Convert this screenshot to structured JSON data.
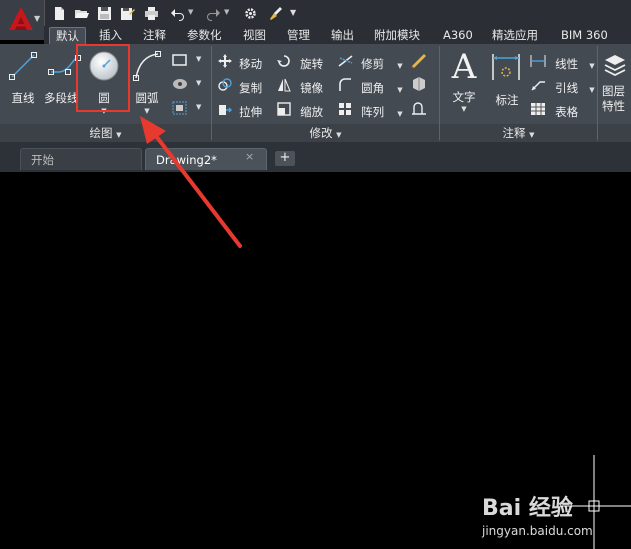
{
  "ribbon_tabs": [
    "默认",
    "插入",
    "注释",
    "参数化",
    "视图",
    "管理",
    "输出",
    "附加模块",
    "A360",
    "精选应用",
    "BIM 360"
  ],
  "draw_panel": {
    "title": "绘图",
    "line_label": "直线",
    "polyline_label": "多段线",
    "circle_label": "圆",
    "arc_label": "圆弧"
  },
  "modify_panel": {
    "title": "修改",
    "move": "移动",
    "rotate": "旋转",
    "trim": "修剪",
    "copy": "复制",
    "mirror": "镜像",
    "fillet": "圆角",
    "stretch": "拉伸",
    "scale": "缩放",
    "array": "阵列"
  },
  "annotation_panel": {
    "title": "注释",
    "text": "文字",
    "dimension": "标注",
    "linear": "线性",
    "leader": "引线",
    "table": "表格"
  },
  "layers_panel": {
    "label_line1": "图层",
    "label_line2": "特性"
  },
  "doc_tabs": {
    "start": "开始",
    "drawing": "Drawing2*",
    "close": "×",
    "new": "+"
  },
  "watermark": {
    "brand": "Bai 经验",
    "url": "jingyan.baidu.com"
  },
  "colors": {
    "highlight": "#e8392f",
    "accent": "#4fa3d9",
    "canvas": "#000000"
  }
}
